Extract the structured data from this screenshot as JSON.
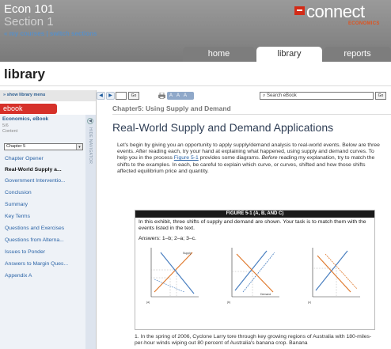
{
  "header": {
    "course_title": "Econ 101",
    "section_title": "Section 1",
    "links": {
      "prefix": "«",
      "my_courses": "my courses",
      "separator": "|",
      "switch_sections": "switch sections"
    },
    "logo": {
      "text": "connect",
      "subtitle": "ECONOMICS"
    },
    "tabs": [
      {
        "label": "home",
        "active": false
      },
      {
        "label": "library",
        "active": true
      },
      {
        "label": "reports",
        "active": false
      }
    ]
  },
  "page_title": "library",
  "toolbar": {
    "show_menu": "» show library menu",
    "go_label": "Go",
    "font_sizes": "A A A",
    "search_placeholder": "Search eBook"
  },
  "sidebar": {
    "tab_label": "ebook",
    "book_title": "Economics, eBook",
    "book_count": "5/6",
    "book_content": "Content",
    "collapse_label": "HIDE NAVIGATOR",
    "chapter_select": "Chapter 5",
    "items": [
      {
        "label": "Chapter Opener",
        "active": false
      },
      {
        "label": "Real-World Supply a...",
        "active": true
      },
      {
        "label": "Government Interventio...",
        "active": false
      },
      {
        "label": "Conclusion",
        "active": false
      },
      {
        "label": "Summary",
        "active": false
      },
      {
        "label": "Key Terms",
        "active": false
      },
      {
        "label": "Questions and Exercises",
        "active": false
      },
      {
        "label": "Questions from Alterna...",
        "active": false
      },
      {
        "label": "Issues to Ponder",
        "active": false
      },
      {
        "label": "Answers to Margin Ques...",
        "active": false
      },
      {
        "label": "Appendix A",
        "active": false
      }
    ]
  },
  "main": {
    "chapter_heading": "Chapter5: Using Supply and Demand",
    "section_heading": "Real-World Supply and Demand Applications",
    "paragraph": {
      "part1": "Let's begin by giving you an opportunity to apply supply/demand analysis to real-world events. Below are three events. After reading each, try your hand at explaining what happened, using supply and demand curves. To help you in the process ",
      "link": "Figure 5-1",
      "part2": " provides some diagrams. ",
      "emphasis": "Before",
      "part3": " reading my explanation, try to match the shifts to the examples. In each, be careful to explain which curve, or curves, shifted and how those shifts affected equilibrium price and quantity."
    },
    "figure": {
      "title": "FIGURE 5-1 (A, B, AND C)",
      "caption": "In this exhibit, three shifts of supply and demand are shown. Your task is to match them with the events listed in the text.",
      "answers": "Answers: 1–b; 2–a; 3–c.",
      "graph_labels": {
        "supply": "Supply",
        "demand": "Demand",
        "panel_a": "(a)",
        "panel_b": "(b)",
        "panel_c": "(c)"
      }
    },
    "footnote": "1.  In the spring of 2006, Cyclone Larry tore through key growing regions of Australia with 180-miles-per-hour winds wiping out 80 percent of Australia's banana crop. Banana"
  },
  "colors": {
    "header_bg": "#8b8b8b",
    "accent_red": "#d6312a",
    "link_blue": "#2a63a6",
    "curve_blue": "#4a7fc0",
    "curve_orange": "#e07a2e",
    "figure_title_bg": "#1a1a1a"
  }
}
